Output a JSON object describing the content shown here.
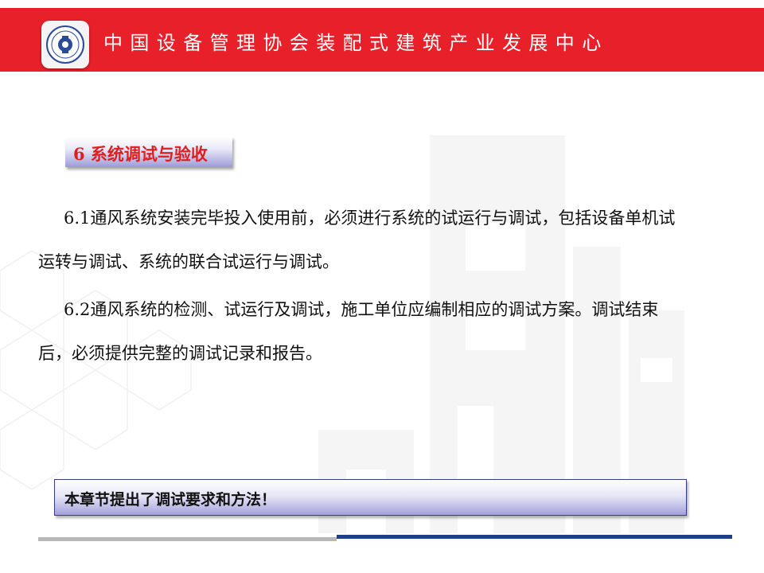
{
  "header": {
    "title": "中国设备管理协会装配式建筑产业发展中心",
    "logo_icon": "association-seal-logo",
    "background_color": "#e8202a"
  },
  "section": {
    "heading": "6 系统调试与验收"
  },
  "paragraphs": [
    {
      "number": "6.1",
      "text": "通风系统安装完毕投入使用前，必须进行系统的试运行与调试，包括设备单机试运转与调试、系统的联合试运行与调试。"
    },
    {
      "number": "6.2",
      "text": "通风系统的检测、试运行及调试，施工单位应编制相应的调试方案。调试结束后，必须提供完整的调试记录和报告。"
    }
  ],
  "summary": {
    "text": "本章节提出了调试要求和方法！"
  },
  "colors": {
    "accent_red": "#e8202a",
    "heading_red": "#e01e1e",
    "footer_blue": "#1e3f8a",
    "footer_grey": "#b8b8b8"
  }
}
